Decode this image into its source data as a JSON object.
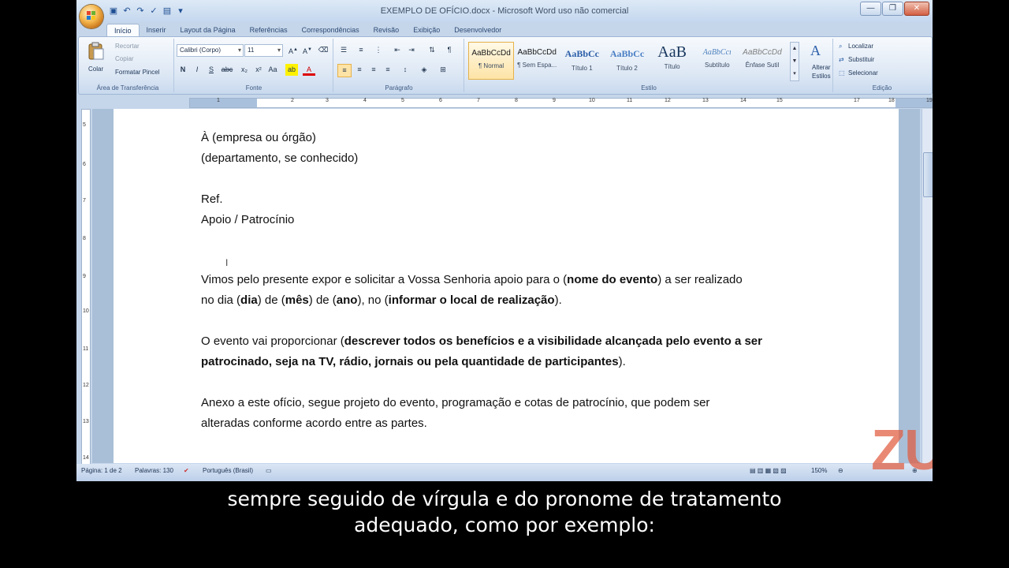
{
  "window": {
    "title": "EXEMPLO DE OFÍCIO.docx - Microsoft Word uso não comercial",
    "minimize": "—",
    "maximize": "❐",
    "close": "✕"
  },
  "tabs": [
    {
      "label": "Início",
      "active": true
    },
    {
      "label": "Inserir"
    },
    {
      "label": "Layout da Página"
    },
    {
      "label": "Referências"
    },
    {
      "label": "Correspondências"
    },
    {
      "label": "Revisão"
    },
    {
      "label": "Exibição"
    },
    {
      "label": "Desenvolvedor"
    }
  ],
  "ribbon": {
    "clipboard": {
      "paste": "Colar",
      "cut": "Recortar",
      "copy": "Copiar",
      "format_painter": "Formatar Pincel",
      "label": "Área de Transferência"
    },
    "font": {
      "name": "Calibri (Corpo)",
      "size": "11",
      "label": "Fonte",
      "bold": "N",
      "italic": "I",
      "underline": "S"
    },
    "paragraph": {
      "label": "Parágrafo"
    },
    "styles": {
      "label": "Estilo",
      "items": [
        {
          "sample": "AaBbCcDd",
          "name": "¶ Normal"
        },
        {
          "sample": "AaBbCcDd",
          "name": "¶ Sem Espa..."
        },
        {
          "sample": "AaBbCc",
          "name": "Título 1"
        },
        {
          "sample": "AaBbCc",
          "name": "Título 2"
        },
        {
          "sample": "AaB",
          "name": "Título"
        },
        {
          "sample": "AaBbCcı",
          "name": "Subtítulo"
        },
        {
          "sample": "AaBbCcDd",
          "name": "Ênfase Sutil"
        }
      ],
      "change_styles_line1": "Alterar",
      "change_styles_line2": "Estilos"
    },
    "editing": {
      "find": "Localizar",
      "replace": "Substituir",
      "select": "Selecionar",
      "label": "Edição"
    }
  },
  "document": {
    "line1": "À (empresa ou órgão)",
    "line2": "(departamento, se conhecido)",
    "line3": "Ref.",
    "line4": "Apoio / Patrocínio",
    "p1a_pre": "Vimos pelo presente expor e solicitar a Vossa Senhoria apoio para o (",
    "p1a_bold": "nome do evento",
    "p1a_post": ") a ser realizado",
    "p1b_1": "no dia (",
    "p1b_b1": "dia",
    "p1b_2": ") de (",
    "p1b_b2": "mês",
    "p1b_3": ") de (",
    "p1b_b3": "ano",
    "p1b_4": "), no (",
    "p1b_b4": "informar o local de realização",
    "p1b_5": ").",
    "p2a_pre": "O evento vai proporcionar (",
    "p2a_bold": "descrever todos os benefícios e a visibilidade alcançada pelo evento a ser",
    "p2b_bold": "patrocinado, seja na TV, rádio, jornais ou pela quantidade de participantes",
    "p2b_post": ").",
    "p3a": "Anexo a este ofício, segue projeto do evento, programação e cotas de patrocínio, que podem ser",
    "p3b": "alteradas conforme acordo entre as partes."
  },
  "status": {
    "page": "Página: 1 de 2",
    "words": "Palavras: 130",
    "language": "Português (Brasil)",
    "zoom": "150%"
  },
  "watermark": "ZUN",
  "subtitle": {
    "line1": "sempre seguido de vírgula e do pronome de tratamento",
    "line2": "adequado, como por exemplo:"
  }
}
